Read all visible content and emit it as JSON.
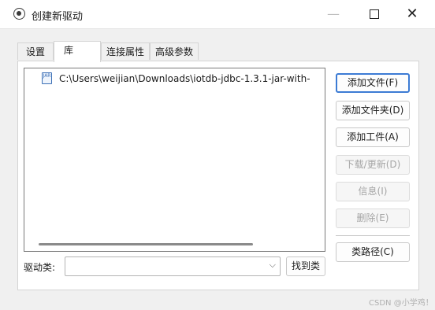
{
  "window": {
    "title": "创建新驱动",
    "min_icon": "—",
    "max_icon": "square",
    "close_icon": "✕"
  },
  "tabs": [
    {
      "label": "设置"
    },
    {
      "label": "库"
    },
    {
      "label": "连接属性"
    },
    {
      "label": "高级参数"
    }
  ],
  "library": {
    "items": [
      {
        "icon": "jar-file-icon",
        "icon_text": "JAR",
        "text": "C:\\Users\\weijian\\Downloads\\iotdb-jdbc-1.3.1-jar-with-"
      }
    ]
  },
  "buttons": {
    "add_file": "添加文件(F)",
    "add_folder": "添加文件夹(D)",
    "add_artifact": "添加工件(A)",
    "download_update": "下载/更新(D)",
    "info": "信息(I)",
    "delete": "删除(E)",
    "classpath": "类路径(C)",
    "find_class": "找到类"
  },
  "driver_class": {
    "label": "驱动类:",
    "value": "",
    "arrow": "⌵"
  },
  "watermark": "CSDN @小学鸡！",
  "colors": {
    "accent": "#3c7bd4",
    "disabled_text": "#a5a5a5",
    "window_bg": "#f0f0f0"
  }
}
